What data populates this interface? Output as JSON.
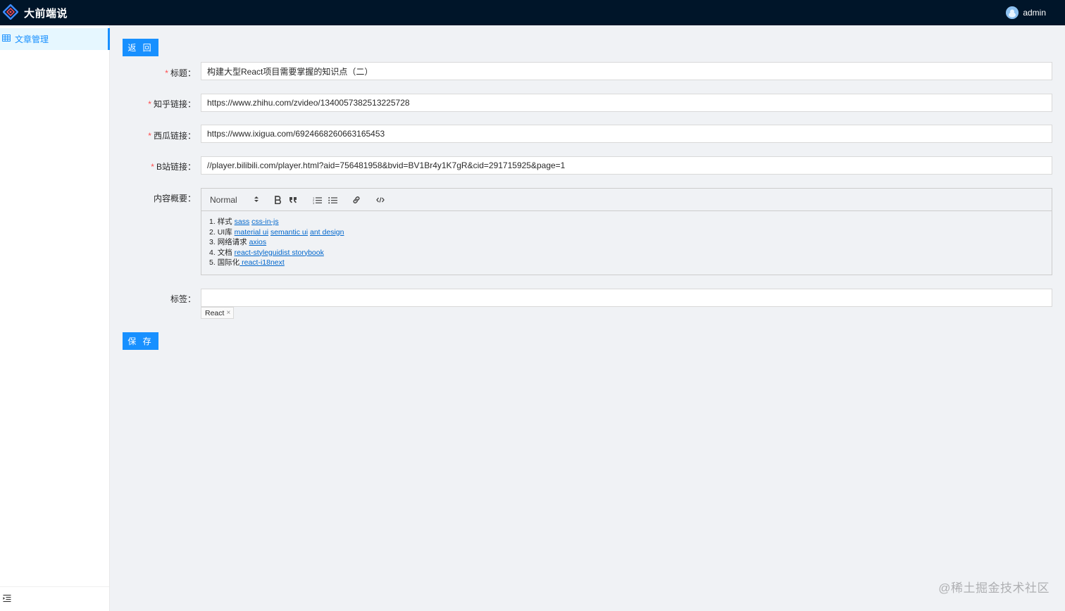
{
  "header": {
    "brand_title": "大前端说",
    "username": "admin",
    "logo_icon": "react-diamond-logo-icon",
    "accent": "#1890ff",
    "bg_color": "#001529"
  },
  "sidebar": {
    "items": [
      {
        "label": "文章管理",
        "icon": "table-icon",
        "active": true
      }
    ],
    "collapse_icon": "menu-fold-icon"
  },
  "form": {
    "back_label": "返 回",
    "save_label": "保 存",
    "fields": {
      "title": {
        "label": "标题",
        "value": "构建大型React项目需要掌握的知识点（二）",
        "required": true
      },
      "zhihu": {
        "label": "知乎链接",
        "value": "https://www.zhihu.com/zvideo/1340057382513225728",
        "required": true
      },
      "xigua": {
        "label": "西瓜链接",
        "value": "https://www.ixigua.com/6924668260663165453",
        "required": true
      },
      "bilibili": {
        "label": "B站链接",
        "value": "//player.bilibili.com/player.html?aid=756481958&bvid=BV1Br4y1K7gR&cid=291715925&page=1",
        "required": true
      },
      "summary": {
        "label": "内容概要",
        "required": false
      },
      "tags": {
        "label": "标签",
        "value": "",
        "required": false
      }
    },
    "colon": "：",
    "required_mark": "*"
  },
  "editor": {
    "format_select": "Normal",
    "toolbar_icons": [
      "bold-icon",
      "blockquote-icon",
      "ordered-list-icon",
      "bullet-list-icon",
      "link-icon",
      "code-block-icon"
    ],
    "lines": [
      {
        "num": "1.",
        "text": "样式",
        "links": [
          "sass",
          "css-in-js"
        ]
      },
      {
        "num": "2.",
        "text": "UI库",
        "links": [
          "material ui",
          "semantic ui",
          "ant design"
        ]
      },
      {
        "num": "3.",
        "text": "网络请求",
        "links": [
          "axios "
        ]
      },
      {
        "num": "4.",
        "text": "文档",
        "links": [
          "react-styleguidist ",
          "storybook"
        ]
      },
      {
        "num": "5.",
        "text": "国际化",
        "links": [
          " react-i18next"
        ]
      }
    ]
  },
  "tags": [
    {
      "label": "React",
      "close": "×"
    }
  ],
  "watermark": "@稀土掘金技术社区"
}
